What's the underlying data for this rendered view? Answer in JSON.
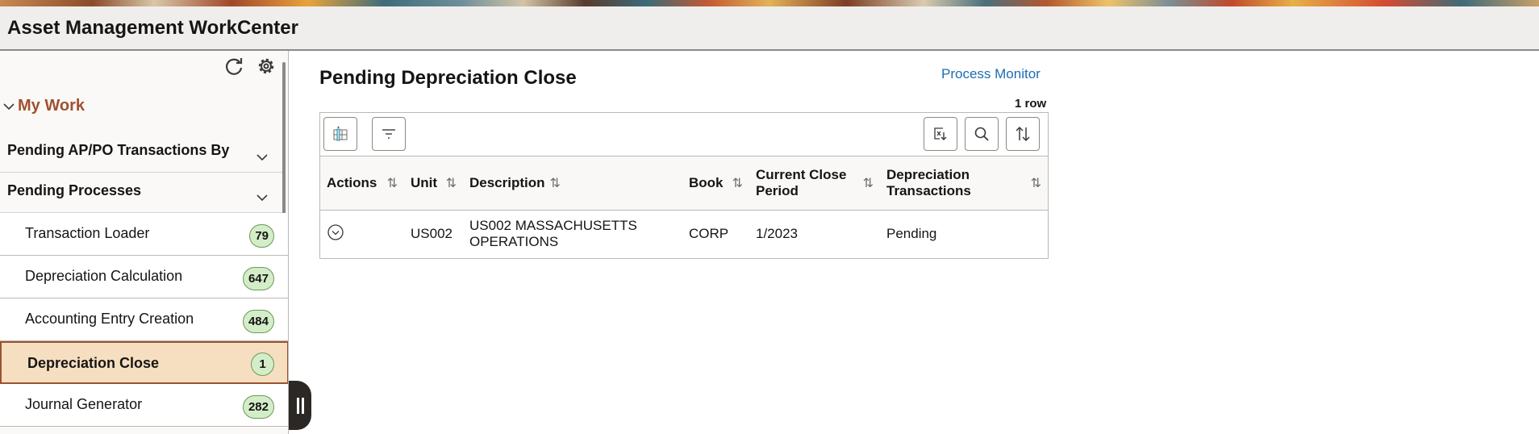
{
  "app": {
    "title": "Asset Management WorkCenter"
  },
  "sidebar": {
    "section_title": "My Work",
    "groups": [
      {
        "label": "Pending AP/PO Transactions By"
      },
      {
        "label": "Pending Processes"
      }
    ],
    "items": [
      {
        "label": "Transaction Loader",
        "count": "79"
      },
      {
        "label": "Depreciation Calculation",
        "count": "647"
      },
      {
        "label": "Accounting Entry Creation",
        "count": "484"
      },
      {
        "label": "Depreciation Close",
        "count": "1",
        "selected": true
      },
      {
        "label": "Journal Generator",
        "count": "282"
      }
    ]
  },
  "main": {
    "title": "Pending Depreciation Close",
    "process_monitor_link": "Process Monitor",
    "row_count": "1 row",
    "columns": [
      {
        "label": "Actions"
      },
      {
        "label": "Unit"
      },
      {
        "label": "Description"
      },
      {
        "label": "Book"
      },
      {
        "label": "Current Close Period"
      },
      {
        "label": "Depreciation Transactions"
      }
    ],
    "rows": [
      {
        "unit": "US002",
        "description": "US002 MASSACHUSETTS OPERATIONS",
        "book": "CORP",
        "period": "1/2023",
        "status": "Pending"
      }
    ]
  },
  "colors": {
    "accent": "#a0512e",
    "link": "#1b6db3",
    "badge_bg": "#d4edc9",
    "selected_bg": "#f6dfc1"
  }
}
